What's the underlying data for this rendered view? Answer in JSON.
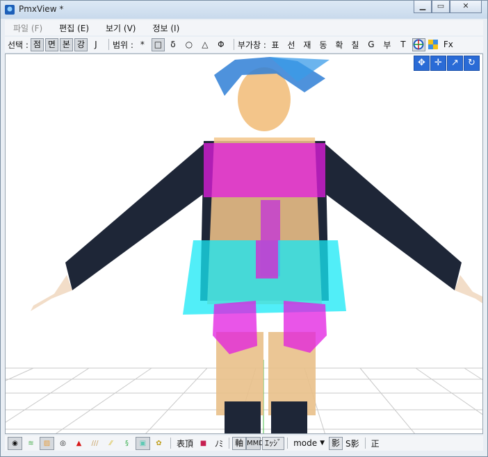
{
  "window": {
    "title": "PmxView *"
  },
  "menus": [
    {
      "label": "파일 (F)",
      "disabled": true
    },
    {
      "label": "편집 (E)"
    },
    {
      "label": "보기 (V)"
    },
    {
      "label": "정보 (I)"
    }
  ],
  "toolbar": {
    "select_label": "선택 :",
    "select_buttons": [
      "점",
      "면",
      "본",
      "강"
    ],
    "j_label": "J",
    "range_label": "범위 :",
    "range_buttons": [
      "*",
      "□",
      "δ",
      "○",
      "△",
      "Φ"
    ],
    "sub_label": "부가창 :",
    "sub_buttons": [
      "표",
      "선",
      "재",
      "동",
      "확",
      "칠",
      "G",
      "부",
      "T"
    ],
    "fx_label": "Fx"
  },
  "nav_icons": [
    "move-all-icon",
    "move-icon",
    "rotate-axis-icon",
    "refresh-rotate-icon"
  ],
  "statusbar": {
    "text1": "表頂",
    "text2": "ﾉﾐ",
    "axis_label": "軸",
    "edge_label": "ｴｯｼﾞ",
    "mode_label": "mode",
    "shadow_label": "影",
    "sshadow_label": "S影",
    "front_label": "正"
  }
}
